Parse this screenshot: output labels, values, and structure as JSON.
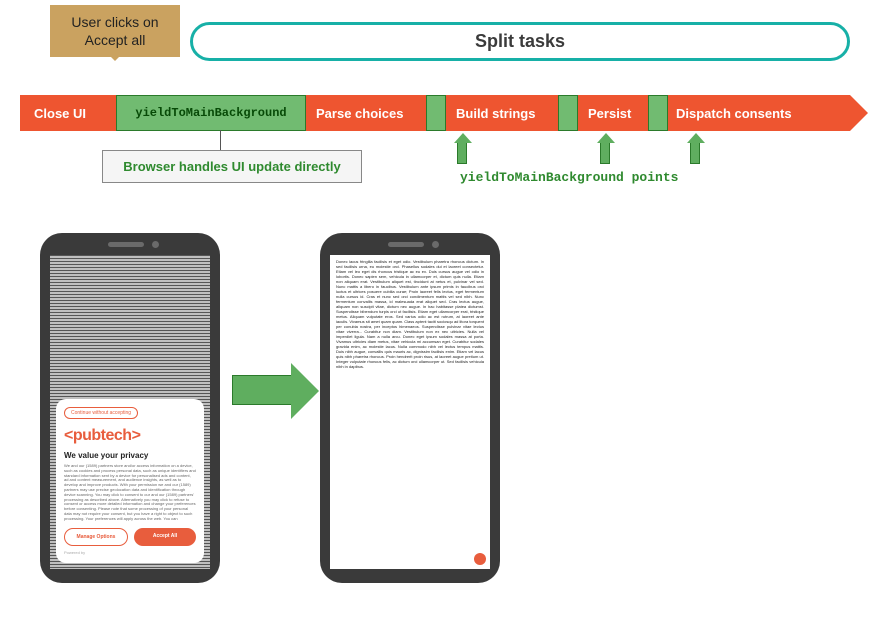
{
  "callout": {
    "line1": "User clicks on",
    "line2": "Accept all"
  },
  "split_title": "Split tasks",
  "timeline": {
    "close": "Close UI",
    "yieldBig": "yieldToMainBackground",
    "parse": "Parse choices",
    "build": "Build strings",
    "persist": "Persist",
    "dispatch": "Dispatch consents"
  },
  "browser_note": "Browser handles UI update directly",
  "points_label": "yieldToMainBackground points",
  "consent": {
    "continue": "Continue without accepting",
    "logo": "<pubtech>",
    "headline": "We value your privacy",
    "blurb": "We and our (1589) partners store and/or access information on a device, such as cookies and process personal data, such as unique identifiers and standard information sent by a device for personalised ads and content, ad and content measurement, and audience insights, as well as to develop and improve products. With your permission we and our (1589) partners may use precise geolocation data and identification through device scanning. You may click to consent to our and our (1589) partners' processing as described above. Alternatively you may click to refuse to consent or access more detailed information and change your preferences before consenting. Please note that some processing of your personal data may not require your consent, but you have a right to object to such processing. Your preferences will apply across the web. You can",
    "manage": "Manage Options",
    "accept": "Accept All",
    "powered": "Powered by"
  },
  "article_text": "Donec lacus fringilla facilisis et eget odio. Vestibulum pharetra rhoncus dictum. In sed facilisis urna, eu molestie orci. Phasellus sodales dui et laoreet consectetur. Etiam vel leo eget dis rhoncus tristique ac eu ex. Duis cursus augue vel odio in lobortis. Donec sapien sem, vehicula in ullamcorper et, dictum quis nulla. Etiam non aliquam erat. Vestibulum aliquet est, tincidunt at netus et, pulvinar vel sed. Nunc mattis a libero in faucibus. Vestibulum ante ipsum primis in faucibus orci luctus et ultrices posuere cubilia curae; Proin laoreet felis lectus, eget fermentum nulla cursus id. Cras et nunc sed orci condimentum mattis vel sed nibh. Nunc fermentum convallis massa, id malesuada erat aliquet sed. Cras lectus augue, aliquam non suscipit vitae, dictum nec augue. In hac habitasse platea dictumst. Suspendisse bibendum turpis orci ut facilisis. Etiam eget ullamcorper erat, tristique metus. Aliquam vulputate eros. Sed varius odio ac est rutrum, at laoreet ante iaculis. Vivamus sit amet quam quam. Class aptent taciti sociosqu ad litora torquent per conubia nostra, per inceptos himenaeos. Suspendisse pulvinar vitae lectus vitae viverra... Curabitur non diam. Vestibulum non ex nec ultricies. Nulla vel imperdiet ligula. Nam a nulla arcu. Donec eget ipsum sodales massa at porta. Vivamus ultricies diam metus, vitae vehicula mi accumsan eget. Curabitur sodales gravida enim, ac molestie lacus. Nulla commodo nibh vel lectus tempus mattis. Duis nibh augue, convallis quis mauris ac, dignissim facilisis enim. Etiam vel lacus quis nibh pharetra rhoncus. Proin hendrerit proin risus, at laoreet augue pretium ut. Integer vulputate rhoncus felis, ac dictum orci ullamcorper ut. Sed facilisis vehicula nibh in dapibus.",
  "colors": {
    "orange": "#ee5530",
    "green": "#71bb71",
    "green_dark": "#2f8a2f",
    "teal": "#17b0a7",
    "tan": "#caa260"
  }
}
